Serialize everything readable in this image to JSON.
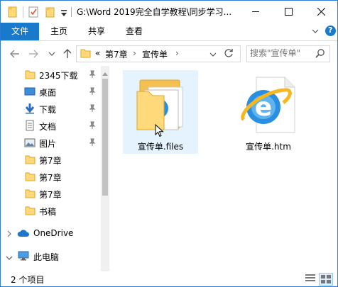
{
  "window": {
    "title": "G:\\Word 2019完全自学教程\\同步学习...",
    "accent": "#1979ca"
  },
  "quick_access": {
    "icons": [
      "folder-icon",
      "properties-checkbox-icon",
      "new-folder-icon",
      "customize-dropdown-icon"
    ]
  },
  "ribbon": {
    "tabs": [
      "文件",
      "主页",
      "共享",
      "查看"
    ]
  },
  "navigation": {
    "back_icon": "arrow-left-icon",
    "forward_icon": "arrow-right-icon",
    "recent_icon": "chevron-down-icon",
    "up_icon": "arrow-up-icon"
  },
  "address": {
    "overflow": "«",
    "segments": [
      "第7章",
      "宣传单"
    ],
    "separator": "›"
  },
  "search": {
    "placeholder": "搜索\"宣传单\""
  },
  "sidebar": {
    "items": [
      {
        "label": "2345下载",
        "icon": "folder-icon",
        "pinned": true
      },
      {
        "label": "桌面",
        "icon": "desktop-icon",
        "pinned": true
      },
      {
        "label": "下载",
        "icon": "download-icon",
        "pinned": true
      },
      {
        "label": "文档",
        "icon": "document-icon",
        "pinned": true
      },
      {
        "label": "图片",
        "icon": "picture-icon",
        "pinned": true
      },
      {
        "label": "第7章",
        "icon": "folder-icon",
        "pinned": false
      },
      {
        "label": "第7章",
        "icon": "folder-icon",
        "pinned": false
      },
      {
        "label": "第7章",
        "icon": "folder-icon",
        "pinned": false
      },
      {
        "label": "书稿",
        "icon": "folder-icon",
        "pinned": false
      },
      {
        "label": "OneDrive",
        "icon": "onedrive-cloud-icon",
        "pinned": false
      },
      {
        "label": "此电脑",
        "icon": "computer-icon",
        "pinned": false
      }
    ]
  },
  "files": [
    {
      "name": "宣传单.files",
      "type": "folder",
      "selected": true
    },
    {
      "name": "宣传单.htm",
      "type": "html-ie-file",
      "selected": false
    }
  ],
  "status": {
    "count": "2 个项目"
  }
}
